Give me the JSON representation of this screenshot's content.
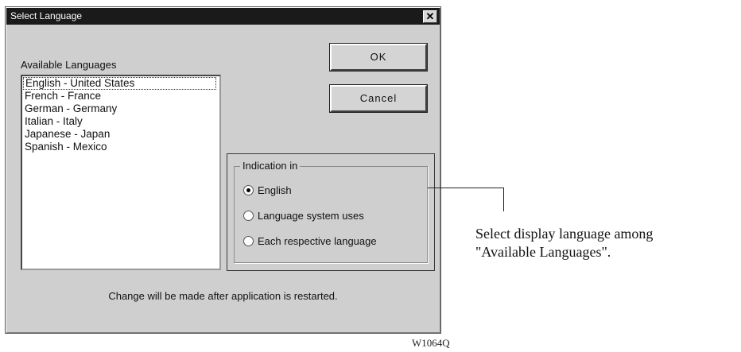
{
  "dialog": {
    "title": "Select Language",
    "close_glyph": "✕",
    "available_label": "Available Languages",
    "languages": [
      "English - United States",
      "French - France",
      "German - Germany",
      "Italian - Italy",
      "Japanese - Japan",
      "Spanish - Mexico"
    ],
    "selected_language_index": 0,
    "ok_label": "OK",
    "cancel_label": "Cancel",
    "indication": {
      "legend": "Indication in",
      "options": [
        "English",
        "Language system uses",
        "Each respective language"
      ],
      "selected_index": 0
    },
    "note": "Change will be made after application is restarted."
  },
  "annotation": {
    "line1": "Select display language among",
    "line2": "\"Available Languages\"."
  },
  "figure_code": "W1064Q"
}
